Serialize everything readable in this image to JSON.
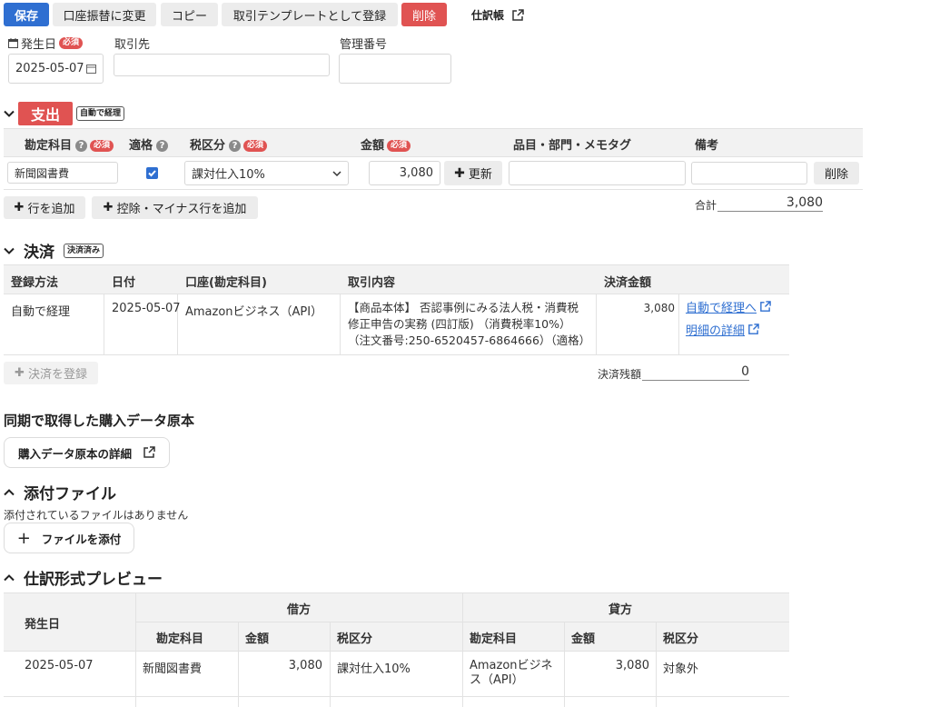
{
  "toolbar": {
    "save": "保存",
    "convert": "口座振替に変更",
    "copy": "コピー",
    "template": "取引テンプレートとして登録",
    "delete": "削除",
    "journal": "仕訳帳"
  },
  "header_fields": {
    "date_label": "発生日",
    "required": "必須",
    "date_value": "2025-05-07",
    "partner_label": "取引先",
    "partner_value": "",
    "number_label": "管理番号",
    "number_value": ""
  },
  "expense": {
    "title": "支出",
    "badge": "自動で経理",
    "columns": {
      "account": "勘定科目",
      "qualified": "適格",
      "tax": "税区分",
      "amount": "金額",
      "item": "品目・部門・メモタグ",
      "memo": "備考"
    },
    "row": {
      "account": "新聞図書費",
      "qualified_checked": true,
      "tax": "課対仕入10%",
      "amount": "3,080",
      "update": "更新",
      "item": "",
      "memo": "",
      "delete": "削除"
    },
    "add_row": "行を追加",
    "add_deduct_row": "控除・マイナス行を追加",
    "total_label": "合計",
    "total_value": "3,080"
  },
  "payment": {
    "title": "決済",
    "badge": "決済済み",
    "columns": {
      "method": "登録方法",
      "date": "日付",
      "account": "口座(勘定科目)",
      "content": "取引内容",
      "amount": "決済金額"
    },
    "row": {
      "method": "自動で経理",
      "date": "2025-05-07",
      "account": "Amazonビジネス（API）",
      "content": "【商品本体】 否認事例にみる法人税・消費税修正申告の実務 (四訂版) （消費税率10%） （注文番号:250-6520457-6864666）（適格）",
      "amount": "3,080",
      "link1": "自動で経理へ",
      "link2": "明細の詳細"
    },
    "register": "決済を登録",
    "balance_label": "決済残額",
    "balance_value": "0"
  },
  "purchase": {
    "title": "同期で取得した購入データ原本",
    "detail_button": "購入データ原本の詳細"
  },
  "attachments": {
    "title": "添付ファイル",
    "empty": "添付されているファイルはありません",
    "attach_button": "ファイルを添付"
  },
  "preview": {
    "title": "仕訳形式プレビュー",
    "date_header": "発生日",
    "debit": "借方",
    "credit": "貸方",
    "sub_account": "勘定科目",
    "sub_amount": "金額",
    "sub_tax": "税区分",
    "row": {
      "date": "2025-05-07",
      "debit_account": "新聞図書費",
      "debit_amount": "3,080",
      "debit_tax": "課対仕入10%",
      "credit_account": "Amazonビジネス（API）",
      "credit_amount": "3,080",
      "credit_tax": "対象外"
    }
  }
}
